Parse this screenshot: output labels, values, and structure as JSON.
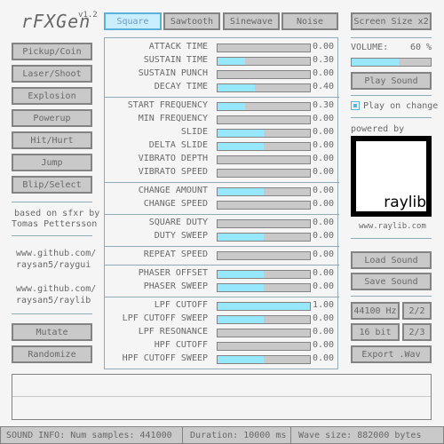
{
  "app": {
    "title": "rFXGen",
    "version": "v1.2"
  },
  "tabs": [
    {
      "label": "Square",
      "active": true
    },
    {
      "label": "Sawtooth",
      "active": false
    },
    {
      "label": "Sinewave",
      "active": false
    },
    {
      "label": "Noise",
      "active": false
    }
  ],
  "top_right": {
    "screen_size_label": "Screen Size x2"
  },
  "left_buttons": [
    "Pickup/Coin",
    "Laser/Shoot",
    "Explosion",
    "Powerup",
    "Hit/Hurt",
    "Jump",
    "Blip/Select"
  ],
  "credits": {
    "based_on_1": "based on sfxr by",
    "based_on_2": "Tomas Pettersson",
    "raygui_1": "www.github.com/",
    "raygui_2": "raysan5/raygui",
    "raylib_1": "www.github.com/",
    "raylib_2": "raysan5/raylib"
  },
  "bottom_left_buttons": {
    "mutate": "Mutate",
    "randomize": "Randomize"
  },
  "params": [
    {
      "label": "ATTACK TIME",
      "value": "0.00",
      "fill": 0.0
    },
    {
      "label": "SUSTAIN TIME",
      "value": "0.30",
      "fill": 0.3
    },
    {
      "label": "SUSTAIN PUNCH",
      "value": "0.00",
      "fill": 0.0
    },
    {
      "label": "DECAY TIME",
      "value": "0.40",
      "fill": 0.4
    },
    {
      "label": "START FREQUENCY",
      "value": "0.30",
      "fill": 0.3
    },
    {
      "label": "MIN FREQUENCY",
      "value": "0.00",
      "fill": 0.0
    },
    {
      "label": "SLIDE",
      "value": "0.00",
      "fill": 0.5
    },
    {
      "label": "DELTA SLIDE",
      "value": "0.00",
      "fill": 0.5
    },
    {
      "label": "VIBRATO DEPTH",
      "value": "0.00",
      "fill": 0.0
    },
    {
      "label": "VIBRATO SPEED",
      "value": "0.00",
      "fill": 0.0
    },
    {
      "label": "CHANGE AMOUNT",
      "value": "0.00",
      "fill": 0.5
    },
    {
      "label": "CHANGE SPEED",
      "value": "0.00",
      "fill": 0.0
    },
    {
      "label": "SQUARE DUTY",
      "value": "0.00",
      "fill": 0.0
    },
    {
      "label": "DUTY SWEEP",
      "value": "0.00",
      "fill": 0.5
    },
    {
      "label": "REPEAT SPEED",
      "value": "0.00",
      "fill": 0.0
    },
    {
      "label": "PHASER OFFSET",
      "value": "0.00",
      "fill": 0.5
    },
    {
      "label": "PHASER SWEEP",
      "value": "0.00",
      "fill": 0.5
    },
    {
      "label": "LPF CUTOFF",
      "value": "1.00",
      "fill": 1.0
    },
    {
      "label": "LPF CUTOFF SWEEP",
      "value": "0.00",
      "fill": 0.5
    },
    {
      "label": "LPF RESONANCE",
      "value": "0.00",
      "fill": 0.0
    },
    {
      "label": "HPF CUTOFF",
      "value": "0.00",
      "fill": 0.0
    },
    {
      "label": "HPF CUTOFF SWEEP",
      "value": "0.00",
      "fill": 0.5
    }
  ],
  "volume": {
    "label": "VOLUME:",
    "value": "60 %",
    "fill": 0.6
  },
  "play_sound": "Play Sound",
  "play_on_change": {
    "label": "Play on change",
    "checked": true
  },
  "powered_by": "powered by",
  "raylib_logo_text": "raylib",
  "raylib_url": "www.raylib.com",
  "file_buttons": {
    "load": "Load Sound",
    "save": "Save Sound"
  },
  "format": {
    "rate": "44100 Hz",
    "rate_toggle": "2/2",
    "bits": "16 bit",
    "bits_toggle": "2/3",
    "export": "Export .Wav"
  },
  "status": {
    "sound_info": "SOUND INFO: Num samples: 441000",
    "duration": "Duration: 10000 ms",
    "wave_size": "Wave size: 882000 bytes"
  }
}
